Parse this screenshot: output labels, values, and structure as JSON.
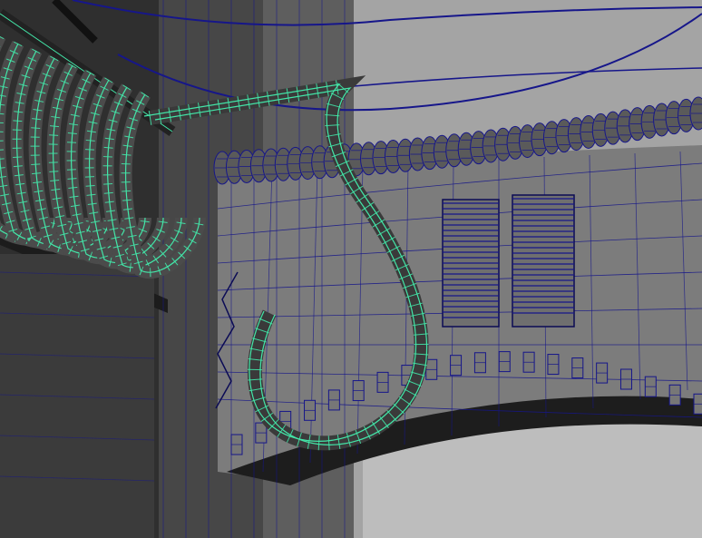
{
  "viewport": {
    "shading_mode": "wireframe-on-shaded"
  },
  "colors": {
    "background_far": "#a4a4a4",
    "wall_dark": "#2f2f2f",
    "wall_mid": "#5e5e5e",
    "wall_light": "#8b8b8b",
    "arch_wall": "#7c7c7c",
    "sky_lower": "#bdbdbd",
    "wire": "#16168a",
    "wire_dark": "#0b0b55",
    "selection": "#43e6a8",
    "selection_fill": "#4b4b4b",
    "overhang_shadow": "#1d1d1d"
  },
  "scene": {
    "objects": [
      "iron-railing",
      "curved-pipe",
      "roof-tiles",
      "shutters",
      "cornice-blocks",
      "overhead-cables"
    ],
    "selected": [
      "iron-railing",
      "curved-pipe"
    ]
  }
}
